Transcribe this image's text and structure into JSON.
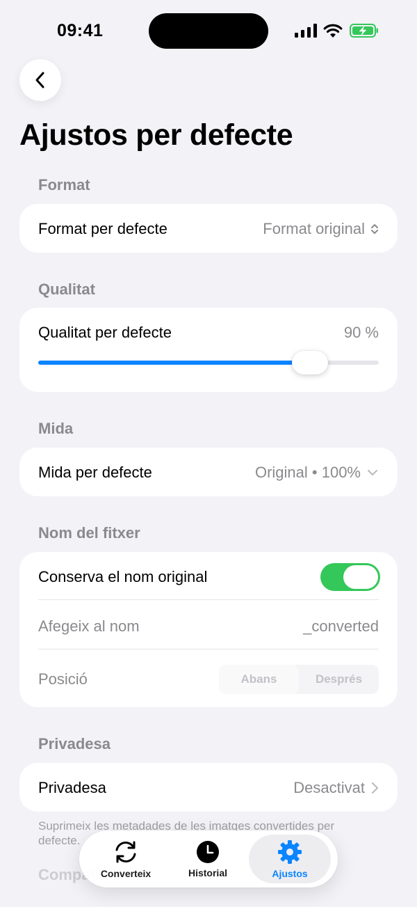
{
  "status": {
    "time": "09:41"
  },
  "page": {
    "title": "Ajustos per defecte"
  },
  "format": {
    "section": "Format",
    "label": "Format per defecte",
    "value": "Format original"
  },
  "quality": {
    "section": "Qualitat",
    "label": "Qualitat per defecte",
    "value_text": "90 %",
    "value": 0.9
  },
  "size": {
    "section": "Mida",
    "label": "Mida per defecte",
    "value": "Original • 100%"
  },
  "filename": {
    "section": "Nom del fitxer",
    "keep_label": "Conserva el nom original",
    "keep_enabled": true,
    "suffix_label": "Afegeix al nom",
    "suffix_value": "_converted",
    "position_label": "Posició",
    "position_options": [
      "Abans",
      "Després"
    ]
  },
  "privacy": {
    "section": "Privadesa",
    "label": "Privadesa",
    "value": "Desactivat",
    "footnote": "Suprimeix les metadades de les imatges convertides per defecte."
  },
  "partial_section": "Compatibilitat",
  "tabs": [
    {
      "label": "Converteix",
      "icon": "refresh-icon"
    },
    {
      "label": "Historial",
      "icon": "clock-icon"
    },
    {
      "label": "Ajustos",
      "icon": "gear-icon",
      "active": true
    }
  ],
  "colors": {
    "accent": "#0A84FF",
    "toggle_on": "#34C759",
    "background": "#F2F2F7"
  }
}
